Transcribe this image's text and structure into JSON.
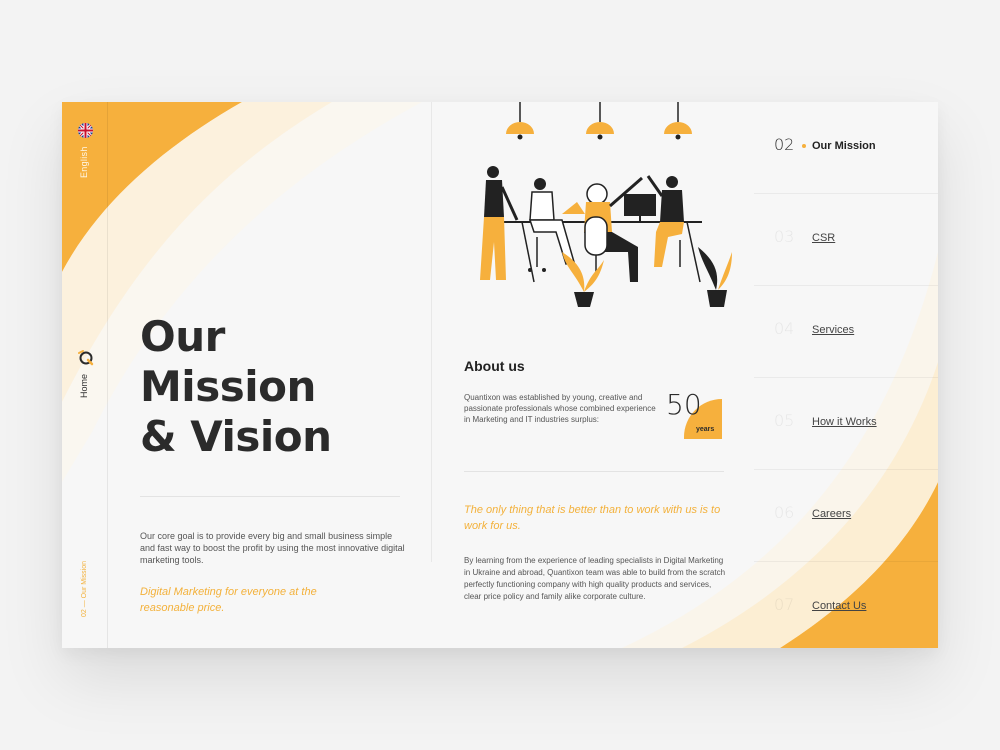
{
  "sidebar": {
    "language": "English",
    "home": "Home",
    "section_indicator": "02 — Our Mission"
  },
  "hero": {
    "title_lines": [
      "Our",
      "Mission",
      "& Vision"
    ],
    "core_goal": "Our core goal is to provide every big and small business simple and fast way to boost the profit by using the most innovative digital marketing tools.",
    "tagline": "Digital Marketing for everyone at the reasonable price."
  },
  "about": {
    "title": "About us",
    "body": "Quantixon was established by young, creative and passionate professionals whose combined experience in Marketing and IT industries surplus:",
    "years_value": "50",
    "years_label": "years",
    "tagline": "The only thing that is better than to work with us is to work for us.",
    "long_text": "By learning from the experience of leading specialists in Digital Marketing in Ukraine and abroad, Quantixon team was able to build from the scratch perfectly functioning company with high quality products and services, clear price policy and family alike corporate culture."
  },
  "nav": {
    "items": [
      {
        "num": "02",
        "label": "Our Mission"
      },
      {
        "num": "03",
        "label": "CSR"
      },
      {
        "num": "04",
        "label": "Services"
      },
      {
        "num": "05",
        "label": "How it Works"
      },
      {
        "num": "06",
        "label": "Careers"
      },
      {
        "num": "07",
        "label": "Contact Us"
      }
    ]
  },
  "colors": {
    "accent": "#f6b03d",
    "text_dark": "#2b2b2b",
    "background": "#f7f7f7"
  }
}
